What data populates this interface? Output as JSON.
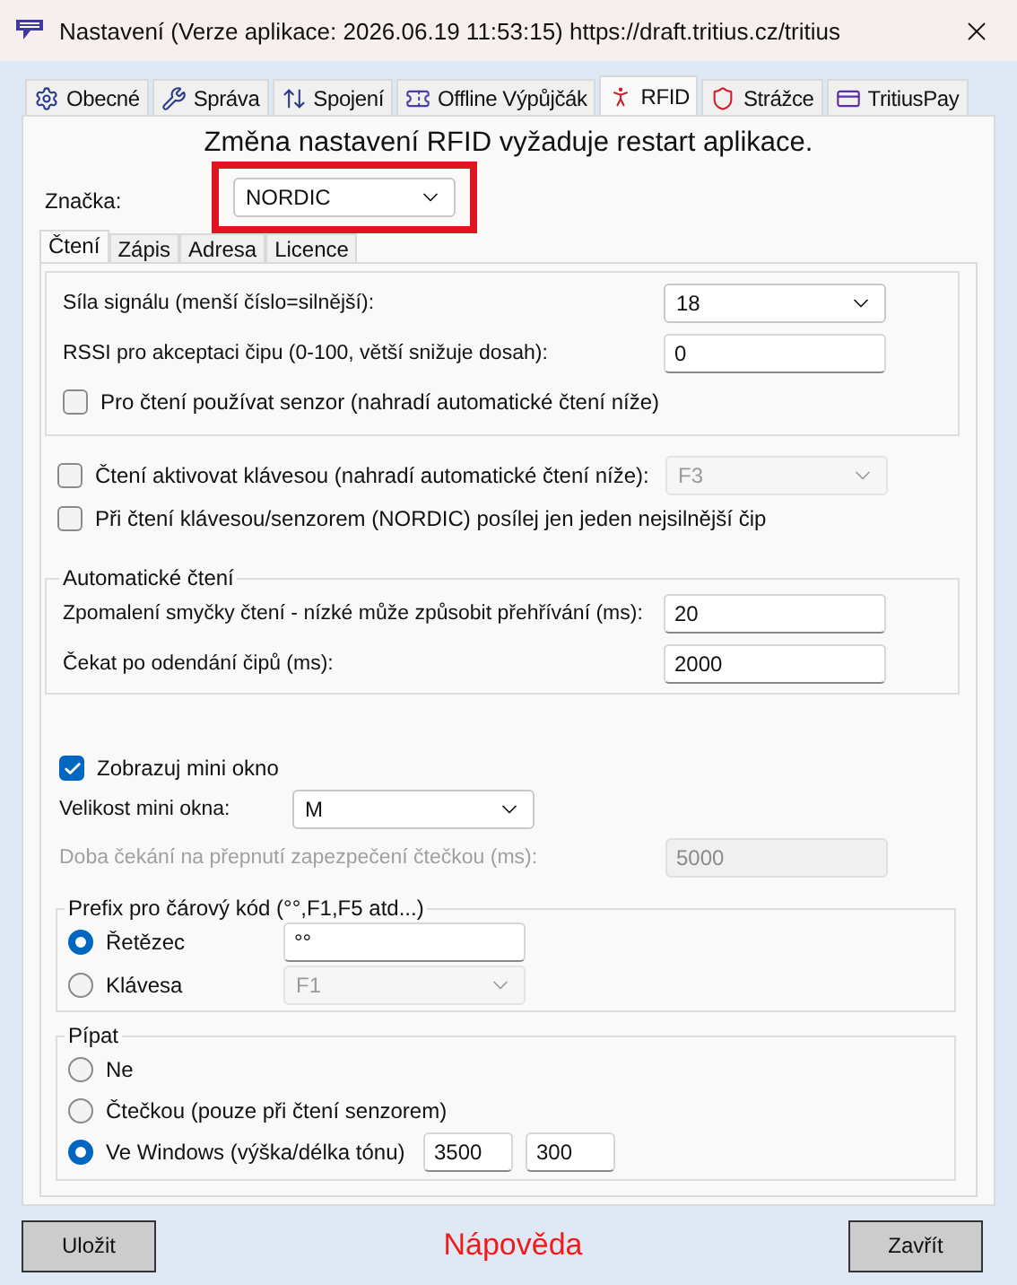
{
  "window": {
    "title": "Nastavení (Verze aplikace: 2026.06.19 11:53:15) https://draft.tritius.cz/tritius"
  },
  "tabs": [
    {
      "label": "Obecné",
      "selected": false
    },
    {
      "label": "Správa",
      "selected": false
    },
    {
      "label": "Spojení",
      "selected": false
    },
    {
      "label": "Offline Výpůjčák",
      "selected": false
    },
    {
      "label": "RFID",
      "selected": true
    },
    {
      "label": "Strážce",
      "selected": false
    },
    {
      "label": "TritiusPay",
      "selected": false
    }
  ],
  "notice": "Změna nastavení RFID vyžaduje restart aplikace.",
  "brand": {
    "label": "Značka:",
    "value": "NORDIC",
    "highlighted": true
  },
  "subtabs": [
    {
      "label": "Čtení",
      "selected": true
    },
    {
      "label": "Zápis",
      "selected": false
    },
    {
      "label": "Adresa",
      "selected": false
    },
    {
      "label": "Licence",
      "selected": false
    }
  ],
  "signal_group": [
    {
      "kind": "select",
      "label": "Síla signálu (menší číslo=silnější):",
      "value": "18"
    },
    {
      "kind": "input",
      "label": "RSSI pro akceptaci čipu (0-100, větší snižuje dosah):",
      "value": "0"
    },
    {
      "kind": "checkbox",
      "label": "Pro čtení používat senzor (nahradí automatické čtení níže)",
      "checked": false
    }
  ],
  "key_options": [
    {
      "kind": "checkbox_select",
      "label": "Čtení aktivovat klávesou (nahradí automatické čtení níže):",
      "checked": false,
      "value": "F3",
      "disabled": true
    },
    {
      "kind": "checkbox",
      "label": "Při čtení klávesou/senzorem (NORDIC) posílej jen jeden nejsilnější čip",
      "checked": false
    }
  ],
  "auto_read": {
    "title": "Automatické čtení",
    "rows": [
      {
        "kind": "input",
        "label": "Zpomalení smyčky čtení - nízké může způsobit přehřívání (ms):",
        "value": "20"
      },
      {
        "kind": "input",
        "label": "Čekat po odendání čipů (ms):",
        "value": "2000"
      }
    ]
  },
  "mini_window": {
    "show": {
      "label": "Zobrazuj mini okno",
      "checked": true
    },
    "size": {
      "label": "Velikost mini okna:",
      "value": "M"
    },
    "wait": {
      "label": "Doba čekání na přepnutí zapezpečení čtečkou (ms):",
      "value": "5000",
      "disabled": true
    }
  },
  "prefix": {
    "title": "Prefix pro čárový kód (°°,F1,F5 atd...)",
    "options": [
      {
        "kind": "input",
        "label": "Řetězec",
        "selected": true,
        "value": "°°",
        "disabled": false
      },
      {
        "kind": "select",
        "label": "Klávesa",
        "selected": false,
        "value": "F1",
        "disabled": true
      }
    ]
  },
  "beep": {
    "title": "Pípat",
    "options": [
      {
        "label": "Ne",
        "selected": false
      },
      {
        "label": "Čtečkou (pouze při čtení senzorem)",
        "selected": false
      },
      {
        "label": "Ve Windows (výška/délka tónu)",
        "selected": true,
        "values": [
          "3500",
          "300"
        ]
      }
    ]
  },
  "buttons": {
    "save": "Uložit",
    "help": "Nápověda",
    "close": "Zavřít"
  }
}
